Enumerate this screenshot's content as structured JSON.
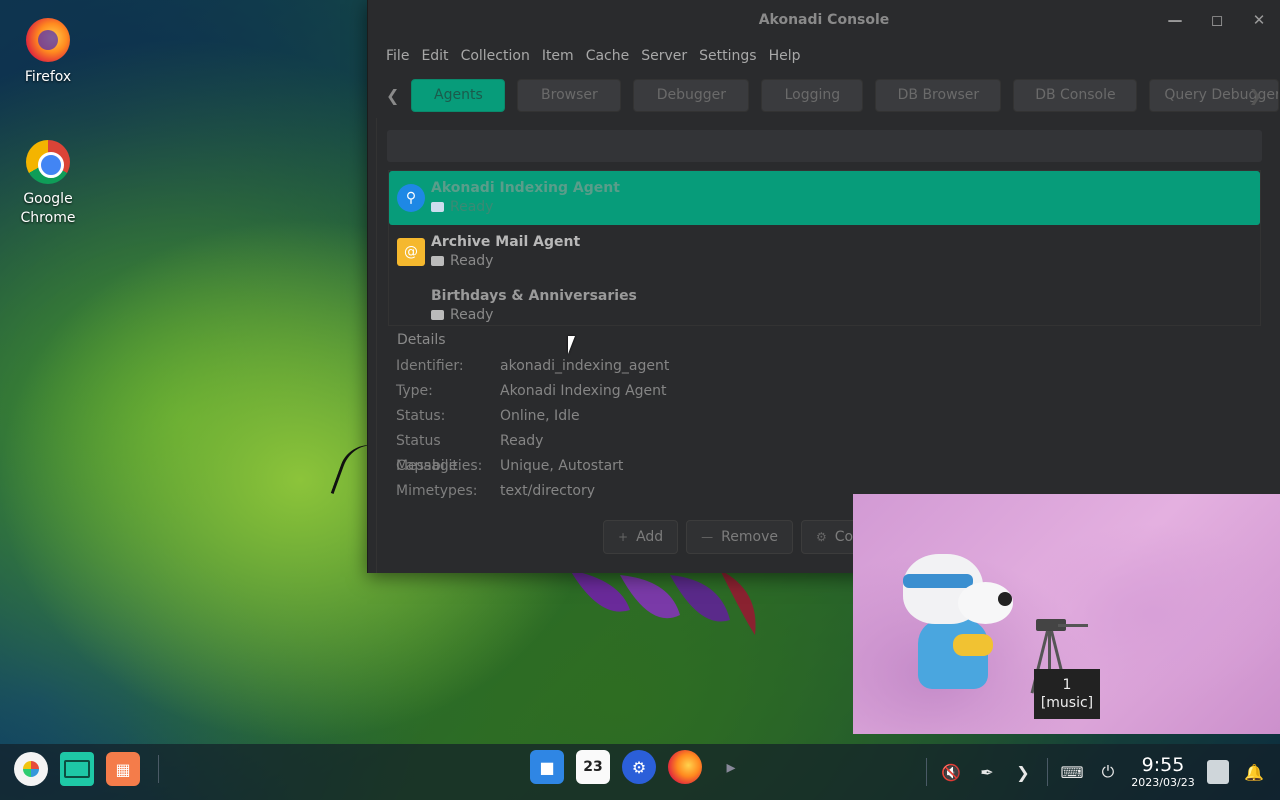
{
  "desktop": {
    "icons": [
      {
        "label": "Firefox"
      },
      {
        "label": "Google Chrome"
      }
    ]
  },
  "window": {
    "title": "Akonadi Console",
    "menu": [
      "File",
      "Edit",
      "Collection",
      "Item",
      "Cache",
      "Server",
      "Settings",
      "Help"
    ],
    "tabs": [
      "Agents",
      "Browser",
      "Debugger",
      "Logging",
      "DB Browser",
      "DB Console",
      "Query Debugger"
    ],
    "active_tab": "Agents",
    "agents": [
      {
        "name": "Akonadi Indexing Agent",
        "status": "Ready",
        "icon": "search-icon"
      },
      {
        "name": "Archive Mail Agent",
        "status": "Ready",
        "icon": "mail-icon"
      },
      {
        "name": "Birthdays & Anniversaries",
        "status": "Ready",
        "icon": "calendar-icon"
      }
    ],
    "details": {
      "title": "Details",
      "rows": [
        {
          "key": "Identifier:",
          "value": "akonadi_indexing_agent"
        },
        {
          "key": "Type:",
          "value": "Akonadi Indexing Agent"
        },
        {
          "key": "Status:",
          "value": "Online, Idle"
        },
        {
          "key": "Status Message:",
          "value": "Ready"
        },
        {
          "key": "Capabilities:",
          "value": "Unique, Autostart"
        },
        {
          "key": "Mimetypes:",
          "value": "text/directory"
        }
      ]
    },
    "buttons": {
      "add": "Add",
      "remove": "Remove",
      "configure": "Con"
    }
  },
  "media_popup": {
    "tooltip_line1": "1",
    "tooltip_line2": "[music]"
  },
  "taskbar": {
    "calendar_day": "23",
    "clock_time": "9:55",
    "clock_date": "2023/03/23"
  },
  "colors": {
    "accent": "#079c7a",
    "window_bg": "#2a2b2d"
  }
}
